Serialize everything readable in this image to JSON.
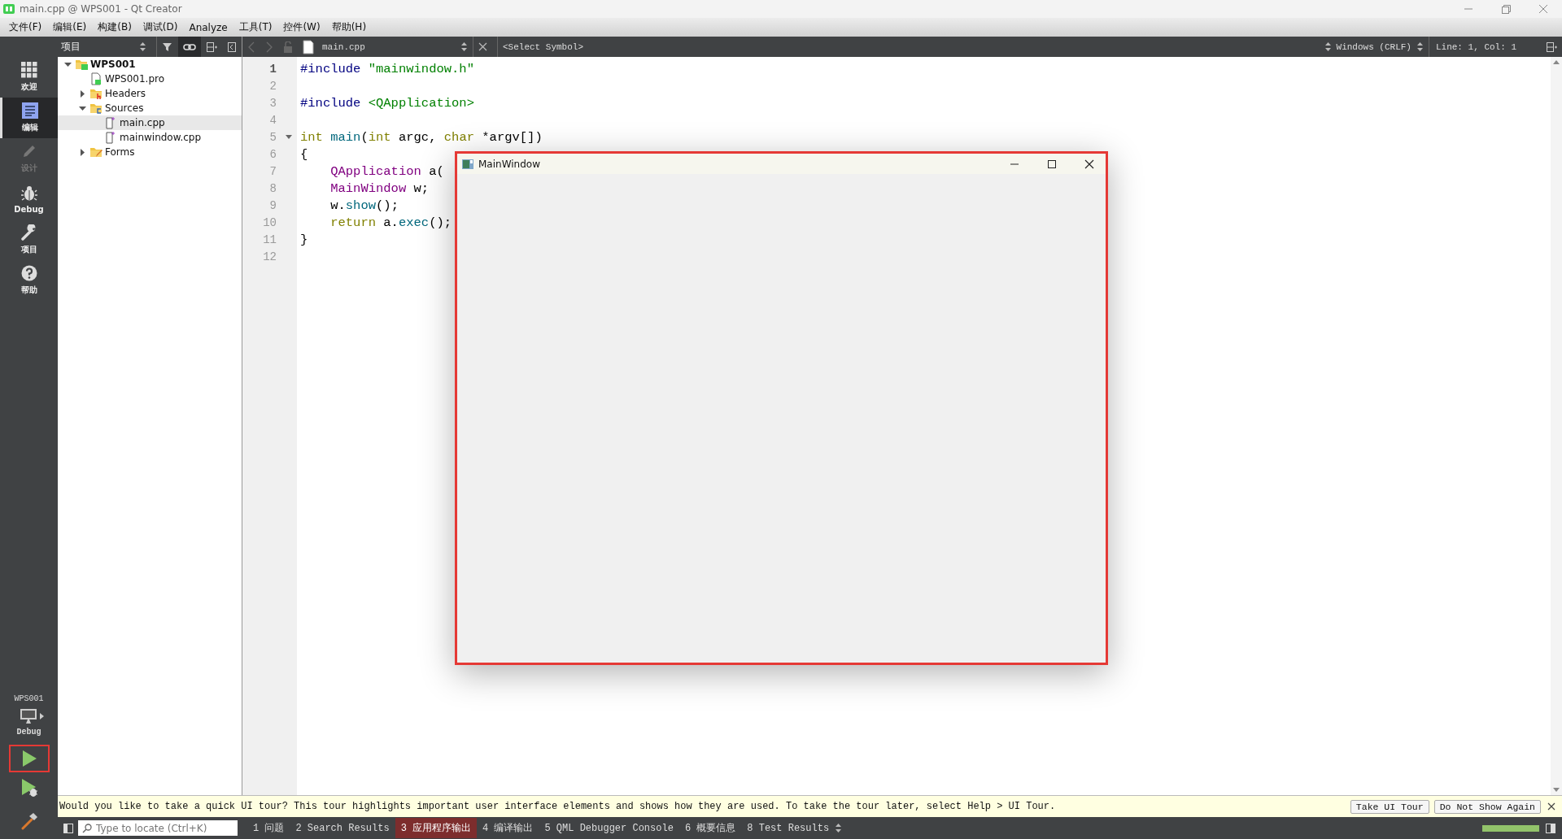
{
  "window": {
    "title": "main.cpp @ WPS001 - Qt Creator"
  },
  "menu": [
    "文件(F)",
    "编辑(E)",
    "构建(B)",
    "调试(D)",
    "Analyze",
    "工具(T)",
    "控件(W)",
    "帮助(H)"
  ],
  "modes": [
    {
      "label": "欢迎",
      "kind": "welcome",
      "selected": false,
      "disabled": false
    },
    {
      "label": "编辑",
      "kind": "edit",
      "selected": true,
      "disabled": false
    },
    {
      "label": "设计",
      "kind": "design",
      "selected": false,
      "disabled": true
    },
    {
      "label": "Debug",
      "kind": "debug",
      "selected": false,
      "disabled": false
    },
    {
      "label": "项目",
      "kind": "projects",
      "selected": false,
      "disabled": false
    },
    {
      "label": "帮助",
      "kind": "help",
      "selected": false,
      "disabled": false
    }
  ],
  "target": {
    "project": "WPS001",
    "build": "Debug"
  },
  "projects": {
    "title": "项目",
    "tree": [
      {
        "name": "WPS001",
        "kind": "project",
        "expanded": true,
        "selected": false,
        "children": [
          {
            "name": "WPS001.pro",
            "kind": "pro-file",
            "selected": false
          },
          {
            "name": "Headers",
            "kind": "headers",
            "expanded": false,
            "selected": false
          },
          {
            "name": "Sources",
            "kind": "sources",
            "expanded": true,
            "selected": false,
            "children": [
              {
                "name": "main.cpp",
                "kind": "source-file",
                "selected": true
              },
              {
                "name": "mainwindow.cpp",
                "kind": "source-file",
                "selected": false
              }
            ]
          },
          {
            "name": "Forms",
            "kind": "forms",
            "expanded": false,
            "selected": false
          }
        ]
      }
    ]
  },
  "editor": {
    "file": "main.cpp",
    "symbol": "<Select Symbol>",
    "line_endings": "Windows (CRLF)",
    "position": "Line: 1, Col: 1",
    "lines": [
      {
        "number": "1",
        "current": true,
        "fold": false,
        "tokens": [
          {
            "kind": "preproc",
            "text": "#include "
          },
          {
            "kind": "string",
            "text": "\"mainwindow.h\""
          }
        ]
      },
      {
        "number": "2",
        "current": false,
        "fold": false
      },
      {
        "number": "3",
        "current": false,
        "fold": false,
        "tokens": [
          {
            "kind": "preproc",
            "text": "#include "
          },
          {
            "kind": "string",
            "text": "<QApplication>"
          }
        ]
      },
      {
        "number": "4",
        "current": false,
        "fold": false
      },
      {
        "number": "5",
        "current": false,
        "fold": true,
        "tokens": [
          {
            "kind": "keyword",
            "text": "int "
          },
          {
            "kind": "func",
            "text": "main"
          },
          {
            "kind": "plain",
            "text": "("
          },
          {
            "kind": "keyword",
            "text": "int"
          },
          {
            "kind": "plain",
            "text": " argc, "
          },
          {
            "kind": "keyword",
            "text": "char"
          },
          {
            "kind": "plain",
            "text": " *argv[])"
          }
        ]
      },
      {
        "number": "6",
        "current": false,
        "fold": false,
        "tokens": [
          {
            "kind": "plain",
            "text": "{"
          }
        ]
      },
      {
        "number": "7",
        "current": false,
        "fold": false,
        "tokens": [
          {
            "kind": "type",
            "text": "    QApplication"
          },
          {
            "kind": "plain",
            "text": " a("
          }
        ]
      },
      {
        "number": "8",
        "current": false,
        "fold": false,
        "tokens": [
          {
            "kind": "type",
            "text": "    MainWindow"
          },
          {
            "kind": "plain",
            "text": " w;"
          }
        ]
      },
      {
        "number": "9",
        "current": false,
        "fold": false,
        "tokens": [
          {
            "kind": "plain",
            "text": "    w."
          },
          {
            "kind": "func",
            "text": "show"
          },
          {
            "kind": "plain",
            "text": "();"
          }
        ]
      },
      {
        "number": "10",
        "current": false,
        "fold": false,
        "tokens": [
          {
            "kind": "keyword",
            "text": "    return"
          },
          {
            "kind": "plain",
            "text": " a."
          },
          {
            "kind": "func",
            "text": "exec"
          },
          {
            "kind": "plain",
            "text": "();"
          }
        ]
      },
      {
        "number": "11",
        "current": false,
        "fold": false,
        "tokens": [
          {
            "kind": "plain",
            "text": "}"
          }
        ]
      },
      {
        "number": "12",
        "current": false,
        "fold": false
      }
    ]
  },
  "app_window": {
    "title": "MainWindow"
  },
  "tour": {
    "message": "Would you like to take a quick UI tour? This tour highlights important user interface elements and shows how they are used. To take the tour later, select Help > UI Tour.",
    "buttons": [
      "Take UI Tour",
      "Do Not Show Again"
    ]
  },
  "status_bar": {
    "locate_placeholder": "Type to locate (Ctrl+K)",
    "tabs": [
      {
        "label": "1 问题",
        "selected": false
      },
      {
        "label": "2 Search Results",
        "selected": false
      },
      {
        "label": "3 应用程序输出",
        "selected": true
      },
      {
        "label": "4 编译输出",
        "selected": false
      },
      {
        "label": "5 QML Debugger Console",
        "selected": false
      },
      {
        "label": "6 概要信息",
        "selected": false
      },
      {
        "label": "8 Test Results",
        "selected": false
      }
    ],
    "progress": {
      "level": 1
    }
  }
}
